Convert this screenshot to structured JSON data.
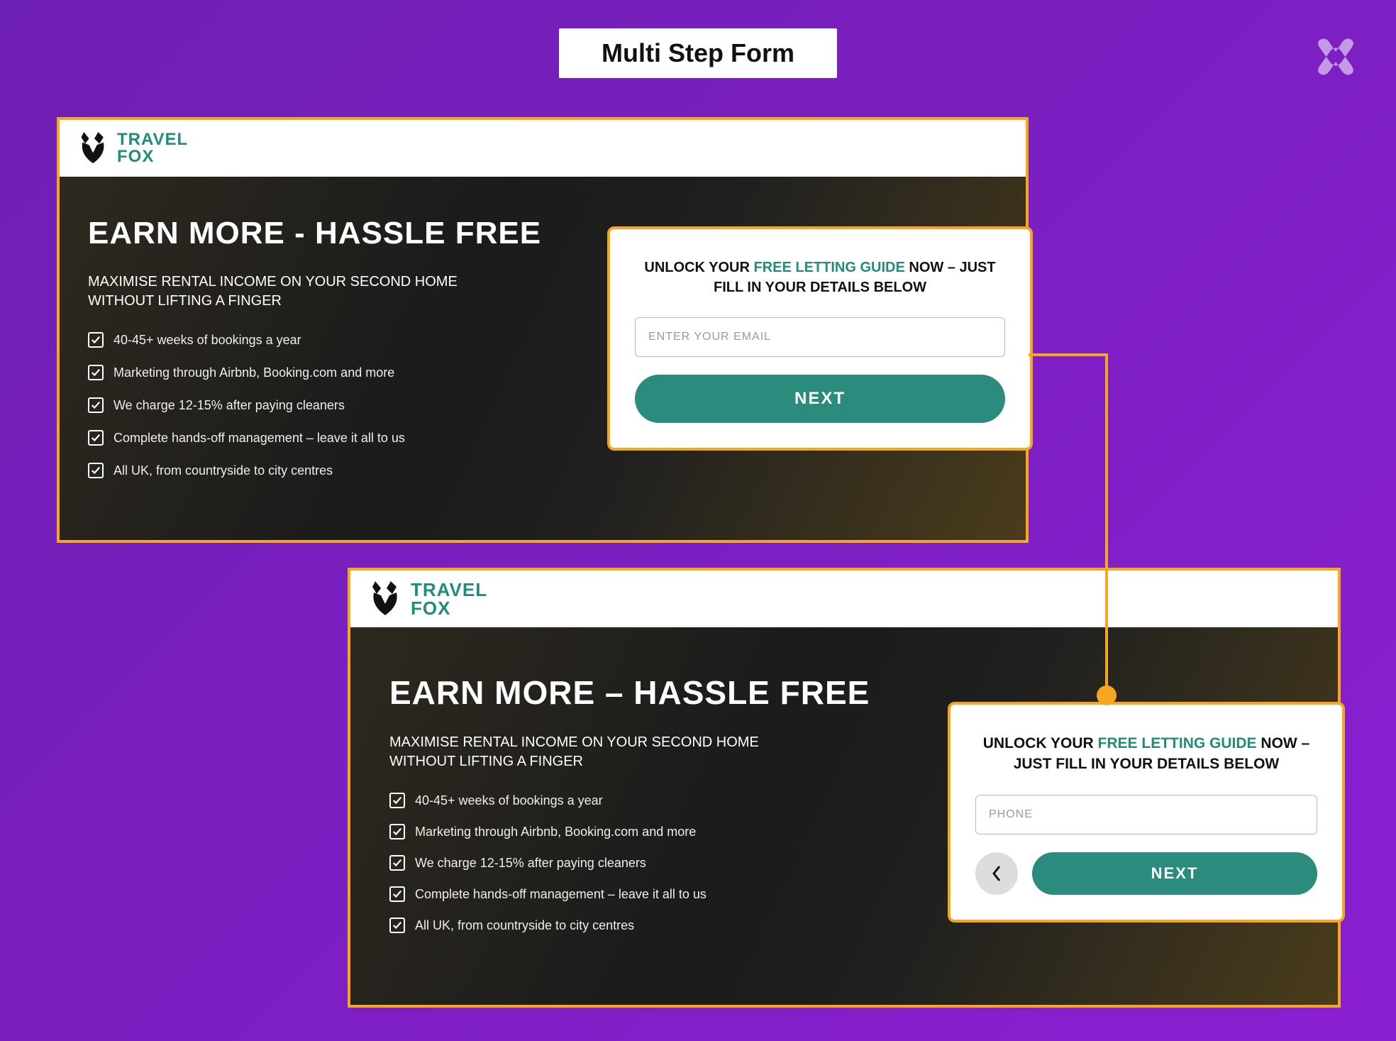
{
  "title": "Multi Step Form",
  "brand": {
    "line1": "TRAVEL",
    "line2": "FOX"
  },
  "hero": {
    "headline": "EARN MORE – HASSLE FREE",
    "headline_alt": "EARN MORE - HASSLE FREE",
    "subhead": "MAXIMISE RENTAL INCOME ON YOUR SECOND HOME WITHOUT LIFTING A FINGER",
    "bullets": [
      "40-45+ weeks of bookings a year",
      "Marketing through Airbnb, Booking.com and more",
      "We charge 12-15% after paying cleaners",
      "Complete hands-off management – leave it all to us",
      "All UK, from countryside to city centres"
    ]
  },
  "form": {
    "title_pre": "UNLOCK YOUR ",
    "title_accent": "FREE LETTING GUIDE",
    "title_post": " NOW – JUST FILL IN YOUR DETAILS BELOW",
    "email_placeholder": "ENTER YOUR EMAIL",
    "phone_placeholder": "PHONE",
    "next_label": "NEXT"
  },
  "colors": {
    "highlight_border": "#f5a623",
    "brand_teal": "#218c7a",
    "button_teal": "#2b8c7e",
    "bg_purple_a": "#6e1fb3",
    "bg_purple_b": "#8a1fd1"
  }
}
